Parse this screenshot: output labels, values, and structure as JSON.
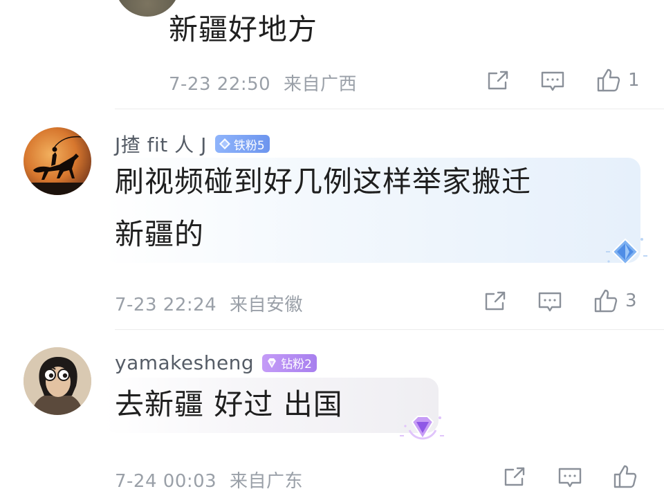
{
  "comments": [
    {
      "text": "新疆好地方",
      "time": "7-23 22:50",
      "location": "来自广西",
      "likes": "1"
    },
    {
      "username": "J揸 fit 人 J",
      "badge": "铁粉5",
      "badge_color": "#7fa6f5",
      "text_line1": "刷视频碰到好几例这样举家搬迁",
      "text_line2": "新疆的",
      "time": "7-23 22:24",
      "location": "来自安徽",
      "likes": "3"
    },
    {
      "username": "yamakesheng",
      "badge": "钻粉2",
      "badge_color": "#b58af0",
      "text": "去新疆 好过 出国",
      "time": "7-24 00:03",
      "location": "来自广东",
      "likes": ""
    }
  ],
  "icons": [
    "share-icon",
    "comment-icon",
    "like-icon",
    "diamond-gem-icon"
  ],
  "colors": {
    "meta_gray": "#9aa0a8",
    "username_gray": "#555c66",
    "bubble_blue": "#eaf2fb",
    "bubble_gray": "#f2f2f4"
  }
}
